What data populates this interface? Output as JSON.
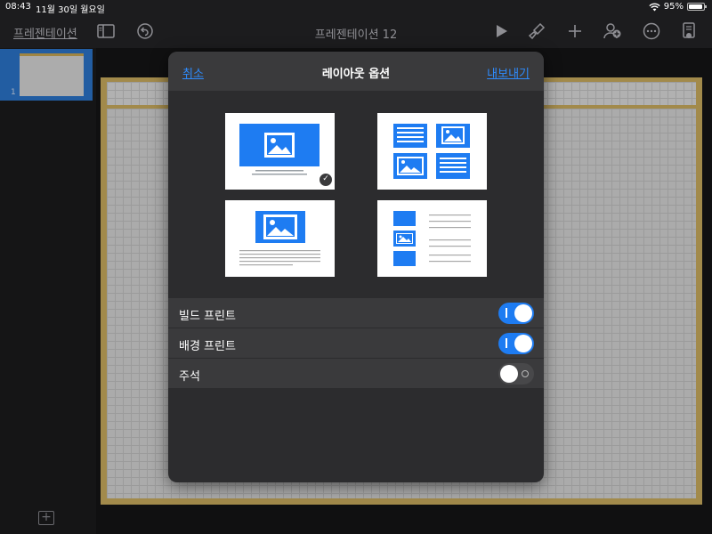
{
  "status_bar": {
    "time": "08:43",
    "date": "11월 30일 월요일",
    "battery": "95%",
    "battery_level": 0.95
  },
  "toolbar": {
    "back_label": "프레젠테이션",
    "title": "프레젠테이션 12",
    "icons": [
      "sidebar-icon",
      "undo-icon",
      "play-icon",
      "brush-icon",
      "plus-icon",
      "collaborate-icon",
      "more-icon",
      "document-icon"
    ]
  },
  "navigator": {
    "slides": [
      {
        "number": "1",
        "selected": true
      }
    ]
  },
  "popover": {
    "cancel_label": "취소",
    "title": "레이아웃 옵션",
    "export_label": "내보내기",
    "layouts": [
      {
        "name": "one-slide-per-page",
        "selected": true
      },
      {
        "name": "grid",
        "selected": false
      },
      {
        "name": "slide-with-notes",
        "selected": false
      },
      {
        "name": "outline",
        "selected": false
      }
    ],
    "options": [
      {
        "label": "빌드 프린트",
        "on": true
      },
      {
        "label": "배경 프린트",
        "on": true
      },
      {
        "label": "주석",
        "on": false
      }
    ]
  },
  "colors": {
    "accent": "#1e7cf2",
    "link": "#2e8cff",
    "slide_border": "#d9b864",
    "background": "#1c1c1e"
  }
}
